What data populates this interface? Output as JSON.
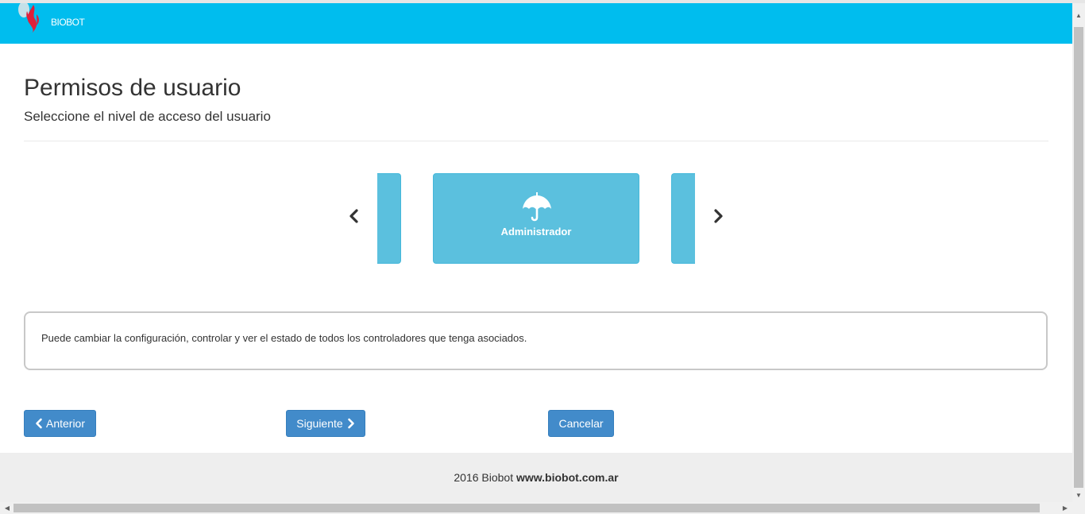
{
  "brand": {
    "name": "BIOBOT",
    "logo_icon": "leaf-logo-icon",
    "navbar_color": "#00bdee"
  },
  "page": {
    "title": "Permisos de usuario",
    "subtitle": "Seleccione el nivel de acceso del usuario"
  },
  "carousel": {
    "prev_icon": "chevron-left-icon",
    "next_icon": "chevron-right-icon",
    "selected": {
      "label": "Administrador",
      "icon": "umbrella-icon"
    },
    "card_color": "#5bc0de"
  },
  "description": "Puede cambiar la configuración, controlar y ver el estado de todos los controladores que tenga asociados.",
  "buttons": {
    "prev": "Anterior",
    "next": "Siguiente",
    "cancel": "Cancelar",
    "color": "#428bca"
  },
  "footer": {
    "text": "2016 Biobot",
    "link": "www.biobot.com.ar"
  }
}
